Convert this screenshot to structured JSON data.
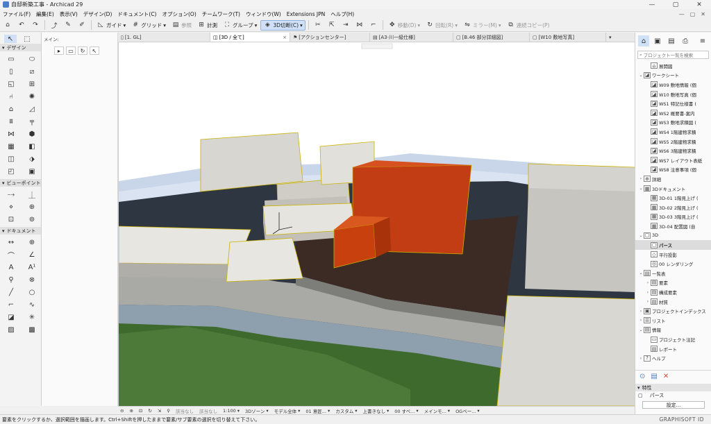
{
  "window": {
    "title": "自邸新築工事 - Archicad 29",
    "controls": [
      "—",
      "▢",
      "✕"
    ]
  },
  "menu": {
    "items": [
      "ファイル(F)",
      "編集(E)",
      "表示(V)",
      "デザイン(D)",
      "ドキュメント(C)",
      "オプション(O)",
      "チームワーク(T)",
      "ウィンドウ(W)",
      "Extensions JPN",
      "ヘルプ(H)"
    ],
    "right": [
      "—",
      "▢",
      "✕"
    ]
  },
  "toolbar": {
    "guide": "ガイド",
    "grid": "グリッド",
    "reference": "参照",
    "measure": "計測",
    "group": "グループ",
    "cut3d": "3D切断(C)",
    "move": "移動(D)",
    "rotate": "回転(R)",
    "mirror": "ミラー(M)",
    "multicopy": "連続コピー(P)"
  },
  "toolbox": {
    "design_label": "デザイン",
    "viewpoint_label": "ビューポイント",
    "document_label": "ドキュメント",
    "infobox_label": "メイン:"
  },
  "tabs": [
    {
      "label": "[1. GL]",
      "icon": "floor-plan-icon",
      "active": false
    },
    {
      "label": "[3D / 全て]",
      "icon": "3d-icon",
      "active": true
    },
    {
      "label": "[アクションセンター]",
      "icon": "action-center-icon",
      "active": false
    },
    {
      "label": "[A3-川一級仕様]",
      "icon": "layout-icon",
      "active": false
    },
    {
      "label": "[B.46 部分詳細図]",
      "icon": "detail-icon",
      "active": false
    },
    {
      "label": "[W10 敷地写真]",
      "icon": "worksheet-icon",
      "active": false
    }
  ],
  "navbar": {
    "items": [
      "該当なし",
      "該当なし",
      "1:100",
      "3Dゾーン",
      "モデル全体",
      "01 意匠...",
      "カスタム",
      "上書きなし",
      "00 すべ...",
      "メインモ...",
      "OGベー..."
    ]
  },
  "status": {
    "message": "要素をクリックするか、選択範囲を描画します。Ctrl+Shiftを押したままで要素/サブ要素の選択を切り替えて下さい。",
    "brand": "GRAPHISOFT ID"
  },
  "navigator": {
    "search_placeholder": "プロジェクト一覧を検索",
    "tree": [
      {
        "depth": 1,
        "twisty": "",
        "icon": "elevation-icon",
        "label": "展開図"
      },
      {
        "depth": 0,
        "twisty": "v",
        "icon": "worksheet-icon",
        "label": "ワークシート"
      },
      {
        "depth": 1,
        "twisty": "",
        "icon": "worksheet-icon",
        "label": "W09 敷地情報 (個"
      },
      {
        "depth": 1,
        "twisty": "",
        "icon": "worksheet-icon",
        "label": "W10 敷地写真 (個"
      },
      {
        "depth": 1,
        "twisty": "",
        "icon": "worksheet-icon",
        "label": "WS1 特記仕様書 ("
      },
      {
        "depth": 1,
        "twisty": "",
        "icon": "worksheet-icon",
        "label": "WS2 概要書-案内"
      },
      {
        "depth": 1,
        "twisty": "",
        "icon": "worksheet-icon",
        "label": "WS3 敷地求積図 ("
      },
      {
        "depth": 1,
        "twisty": "",
        "icon": "worksheet-icon",
        "label": "WS4 1階建物求積"
      },
      {
        "depth": 1,
        "twisty": "",
        "icon": "worksheet-icon",
        "label": "WS5 2階建物求積"
      },
      {
        "depth": 1,
        "twisty": "",
        "icon": "worksheet-icon",
        "label": "WS6 3階建物求積"
      },
      {
        "depth": 1,
        "twisty": "",
        "icon": "worksheet-icon",
        "label": "WS7 レイアウト表紙"
      },
      {
        "depth": 1,
        "twisty": "",
        "icon": "worksheet-icon",
        "label": "WS8 注意事項 (個"
      },
      {
        "depth": 0,
        "twisty": ">",
        "icon": "detail-icon",
        "label": "詳細"
      },
      {
        "depth": 0,
        "twisty": "v",
        "icon": "3d-document-icon",
        "label": "3Dドキュメント"
      },
      {
        "depth": 1,
        "twisty": "",
        "icon": "3d-document-icon",
        "label": "3D-01 1階見上げ ("
      },
      {
        "depth": 1,
        "twisty": "",
        "icon": "3d-document-icon",
        "label": "3D-02 2階見上げ ("
      },
      {
        "depth": 1,
        "twisty": "",
        "icon": "3d-document-icon",
        "label": "3D-03 3階見上げ ("
      },
      {
        "depth": 1,
        "twisty": "",
        "icon": "3d-document-icon",
        "label": "3D-04 配置図 (自"
      },
      {
        "depth": 0,
        "twisty": "v",
        "icon": "3d-icon",
        "label": "3D"
      },
      {
        "depth": 1,
        "twisty": "",
        "icon": "3d-icon",
        "label": "パース",
        "selected": true
      },
      {
        "depth": 1,
        "twisty": "",
        "icon": "parallel-icon",
        "label": "平行投影"
      },
      {
        "depth": 1,
        "twisty": "",
        "icon": "render-icon",
        "label": "00 レンダリング"
      },
      {
        "depth": 0,
        "twisty": "v",
        "icon": "schedule-icon",
        "label": "一覧表"
      },
      {
        "depth": 1,
        "twisty": ">",
        "icon": "schedule-icon",
        "label": "要素"
      },
      {
        "depth": 1,
        "twisty": ">",
        "icon": "schedule-icon",
        "label": "構成要素"
      },
      {
        "depth": 1,
        "twisty": ">",
        "icon": "schedule-icon",
        "label": "材質"
      },
      {
        "depth": 0,
        "twisty": ">",
        "icon": "index-icon",
        "label": "プロジェクトインデックス"
      },
      {
        "depth": 0,
        "twisty": ">",
        "icon": "list-icon",
        "label": "リスト"
      },
      {
        "depth": 0,
        "twisty": "v",
        "icon": "info-icon",
        "label": "情報"
      },
      {
        "depth": 1,
        "twisty": "",
        "icon": "note-icon",
        "label": "プロジェクト注記"
      },
      {
        "depth": 1,
        "twisty": "",
        "icon": "report-icon",
        "label": "レポート"
      },
      {
        "depth": 0,
        "twisty": ">",
        "icon": "help-icon",
        "label": "ヘルプ"
      }
    ]
  },
  "properties": {
    "header": "特性",
    "name": "パース",
    "settings_button": "設定..."
  }
}
